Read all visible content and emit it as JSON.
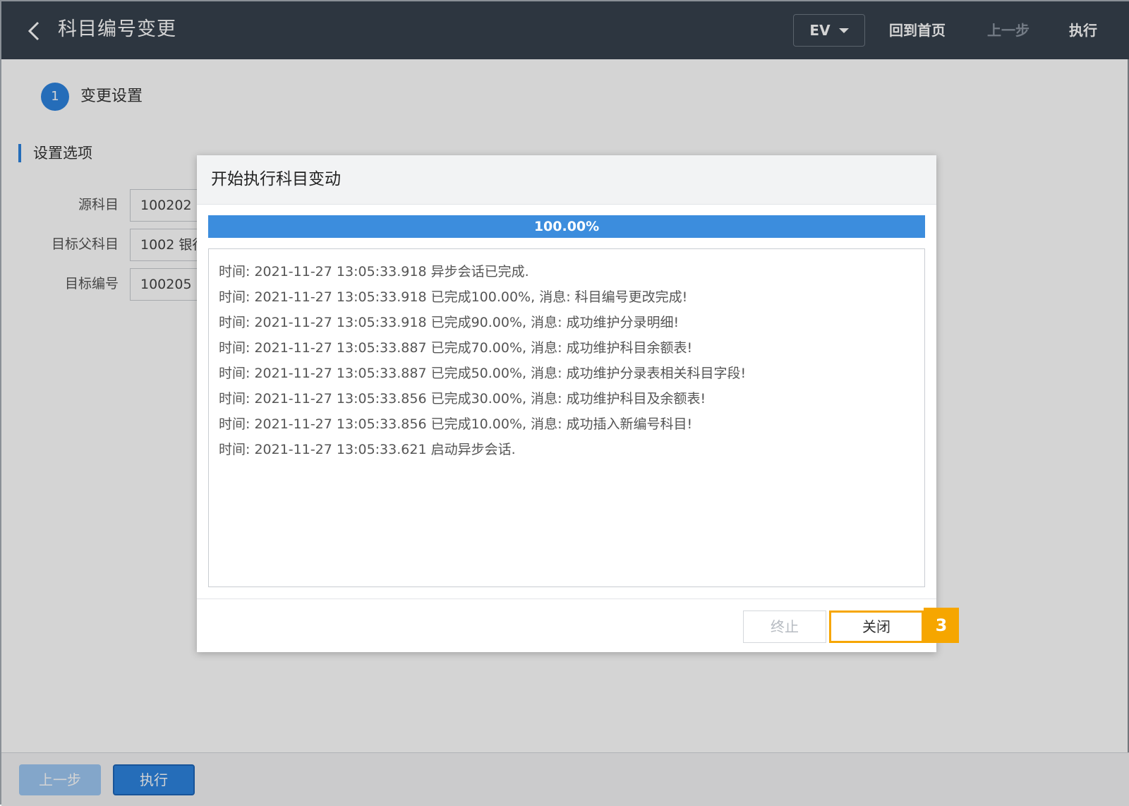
{
  "header": {
    "title": "科目编号变更",
    "ev_select": "EV",
    "home_label": "回到首页",
    "prev_label": "上一步",
    "exec_label": "执行"
  },
  "step": {
    "number": "1",
    "label": "变更设置"
  },
  "section": {
    "title": "设置选项"
  },
  "form": {
    "source_label": "源科目",
    "source_value": "100202 中",
    "parent_label": "目标父科目",
    "parent_value": "1002 银行",
    "code_label": "目标编号",
    "code_value": "100205"
  },
  "footer": {
    "prev_label": "上一步",
    "exec_label": "执行"
  },
  "dialog": {
    "title": "开始执行科目变动",
    "progress_text": "100.00%",
    "progress_fraction": 1.0,
    "log": [
      "时间: 2021-11-27 13:05:33.918 异步会话已完成.",
      "时间: 2021-11-27 13:05:33.918 已完成100.00%, 消息: 科目编号更改完成!",
      "时间: 2021-11-27 13:05:33.918 已完成90.00%, 消息: 成功维护分录明细!",
      "时间: 2021-11-27 13:05:33.887 已完成70.00%, 消息: 成功维护科目余额表!",
      "时间: 2021-11-27 13:05:33.887 已完成50.00%, 消息: 成功维护分录表相关科目字段!",
      "时间: 2021-11-27 13:05:33.856 已完成30.00%, 消息: 成功维护科目及余额表!",
      "时间: 2021-11-27 13:05:33.856 已完成10.00%, 消息: 成功插入新编号科目!",
      "时间: 2021-11-27 13:05:33.621 启动异步会话."
    ],
    "stop_label": "终止",
    "close_label": "关闭"
  },
  "annotation_badge": "3",
  "colors": {
    "header_bg": "#37414d",
    "accent": "#2d84df",
    "progress": "#3c8ddd",
    "highlight": "#f6a600"
  }
}
